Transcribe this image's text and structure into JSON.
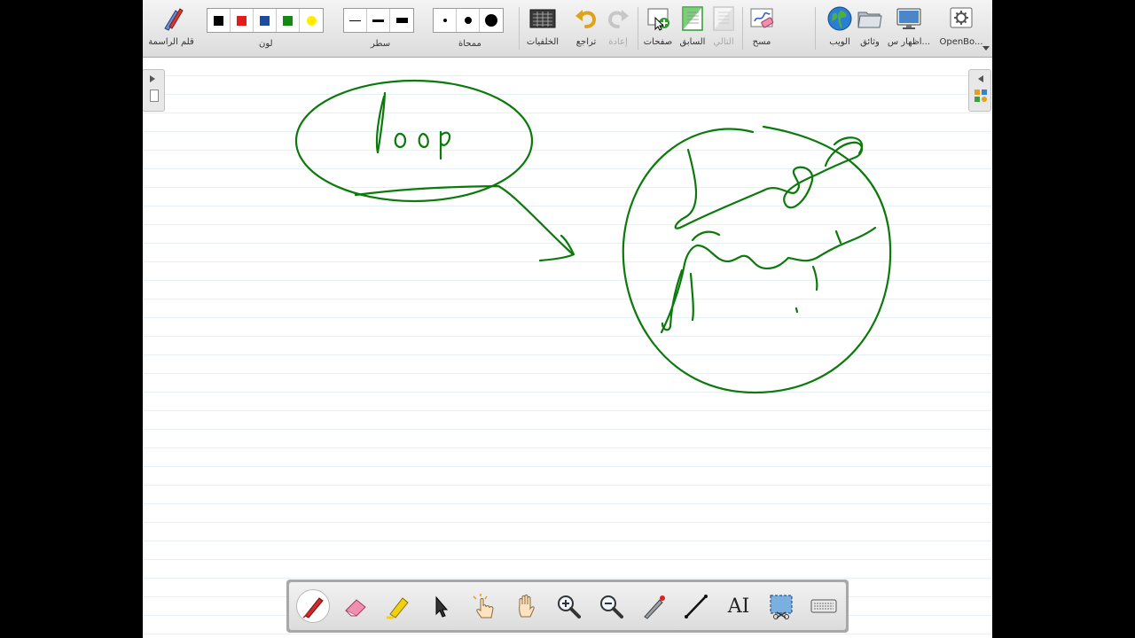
{
  "toolbar": {
    "pen_label": "قلم الراسمة",
    "color_label": "لون",
    "line_label": "سطر",
    "eraser_label": "ممحاة",
    "background_label": "الخلفيات",
    "undo_label": "تراجع",
    "redo_label": "إعادة",
    "pages_label": "صفحات",
    "previous_label": "السابق",
    "next_label": "التالي",
    "clear_label": "مسح",
    "web_label": "الويب",
    "documents_label": "وثائق",
    "display_label": "اظهار س...",
    "openboard_label": "OpenBo...",
    "colors": [
      "#000000",
      "#e31b1b",
      "#1e4aa0",
      "#118a11",
      "#ffee00"
    ],
    "line_widths": [
      "thin",
      "medium",
      "thick"
    ],
    "eraser_sizes": [
      "small",
      "medium",
      "large"
    ]
  },
  "board": {
    "ink_color": "#0b7a0b",
    "handwriting": "loop"
  },
  "palette": {
    "tools": [
      {
        "name": "pen-tool",
        "icon": "pen-icon",
        "active": true
      },
      {
        "name": "eraser-tool",
        "icon": "eraser-icon",
        "active": false
      },
      {
        "name": "highlighter-tool",
        "icon": "highlighter-icon",
        "active": false
      },
      {
        "name": "selector-tool",
        "icon": "arrow-pointer-icon",
        "active": false
      },
      {
        "name": "interact-tool",
        "icon": "interact-hand-icon",
        "active": false
      },
      {
        "name": "hand-tool",
        "icon": "hand-icon",
        "active": false
      },
      {
        "name": "zoom-in-tool",
        "icon": "zoom-in-icon",
        "active": false
      },
      {
        "name": "zoom-out-tool",
        "icon": "zoom-out-icon",
        "active": false
      },
      {
        "name": "laser-pointer-tool",
        "icon": "laser-pointer-icon",
        "active": false
      },
      {
        "name": "line-tool",
        "icon": "line-icon",
        "active": false
      },
      {
        "name": "text-tool",
        "icon": "text-icon",
        "active": false
      },
      {
        "name": "capture-tool",
        "icon": "capture-icon",
        "active": false
      },
      {
        "name": "virtual-keyboard-tool",
        "icon": "keyboard-icon",
        "active": false
      }
    ],
    "text_tool_glyph": "AI"
  }
}
